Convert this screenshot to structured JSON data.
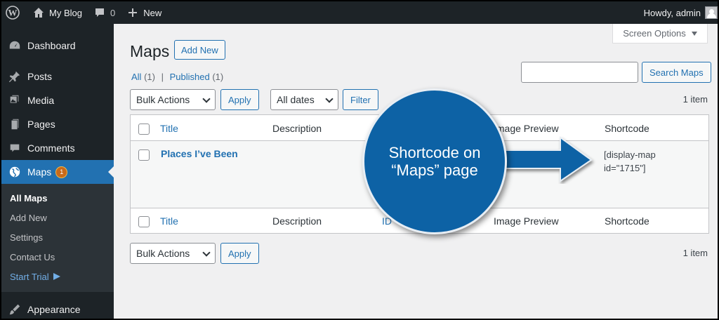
{
  "adminbar": {
    "site_name": "My Blog",
    "comments_count": "0",
    "new_label": "New",
    "howdy": "Howdy, admin"
  },
  "sidebar": {
    "items": [
      {
        "label": "Dashboard",
        "icon": "dashboard-icon"
      },
      {
        "label": "Posts",
        "icon": "pin-icon"
      },
      {
        "label": "Media",
        "icon": "media-icon"
      },
      {
        "label": "Pages",
        "icon": "pages-icon"
      },
      {
        "label": "Comments",
        "icon": "comment-icon"
      },
      {
        "label": "Maps",
        "icon": "globe-icon",
        "badge": "1"
      }
    ],
    "submenu": [
      "All Maps",
      "Add New",
      "Settings",
      "Contact Us",
      "Start Trial"
    ],
    "appearance": "Appearance"
  },
  "main": {
    "screen_options": "Screen Options",
    "title": "Maps",
    "add_new": "Add New",
    "filters": {
      "all": "All",
      "all_count": "(1)",
      "sep": "|",
      "published": "Published",
      "published_count": "(1)"
    },
    "search_placeholder": "",
    "search_button": "Search Maps",
    "bulk_actions": "Bulk Actions",
    "apply": "Apply",
    "all_dates": "All dates",
    "filter": "Filter",
    "item_count": "1 item",
    "columns": {
      "title": "Title",
      "description": "Description",
      "id": "ID",
      "image_preview": "Image Preview",
      "shortcode": "Shortcode"
    },
    "rows": [
      {
        "title": "Places I’ve Been",
        "shortcode_line1": "[display-map",
        "shortcode_line2": "id=\"1715\"]"
      }
    ]
  },
  "callout": {
    "text": "Shortcode on “Maps” page",
    "color": "#0d62a5"
  }
}
